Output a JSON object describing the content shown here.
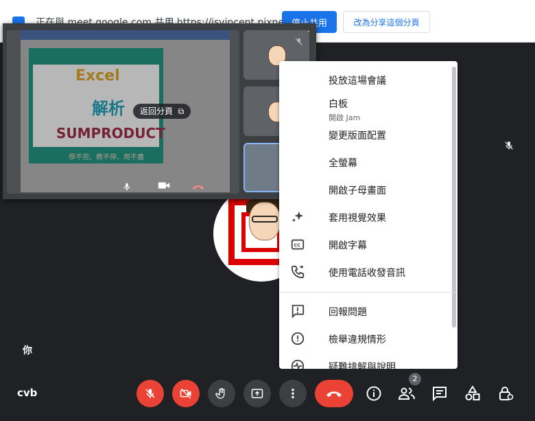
{
  "sharebar": {
    "text": "正在與 meet.google.com 共用 https://isvincent.pixnet.net",
    "stop_label": "停止共用",
    "share_tab_label": "改為分享這個分頁"
  },
  "pip": {
    "slide": {
      "title_en": "Excel",
      "title_zh": "解析",
      "function": "SUMPRODUCT",
      "footer": "學不完、教不停、用不盡"
    },
    "return_label": "返回分頁",
    "more_glyph": "•••"
  },
  "menu": {
    "items": [
      {
        "label": "投放這場會議",
        "icon": "cast-icon"
      },
      {
        "label": "白板",
        "sub": "開啟 Jam",
        "icon": "whiteboard-icon"
      },
      {
        "label": "變更版面配置",
        "icon": "layout-icon"
      },
      {
        "label": "全螢幕",
        "icon": "fullscreen-icon"
      },
      {
        "label": "開啟子母畫面",
        "icon": "picture-in-picture-icon"
      },
      {
        "label": "套用視覺效果",
        "icon": "sparkle-icon"
      },
      {
        "label": "開啟字幕",
        "icon": "captions-icon"
      },
      {
        "label": "使用電話收發音訊",
        "icon": "phone-icon"
      },
      {
        "label": "回報問題",
        "icon": "feedback-icon"
      },
      {
        "label": "檢舉違規情形",
        "icon": "report-icon"
      },
      {
        "label": "疑難排解與說明",
        "icon": "help-icon"
      }
    ]
  },
  "stage": {
    "you_label": "你"
  },
  "bottombar": {
    "meeting_code": "cvb",
    "participants_count": "2"
  },
  "colors": {
    "accent": "#1a73e8",
    "danger": "#ea4335",
    "background": "#202124"
  }
}
